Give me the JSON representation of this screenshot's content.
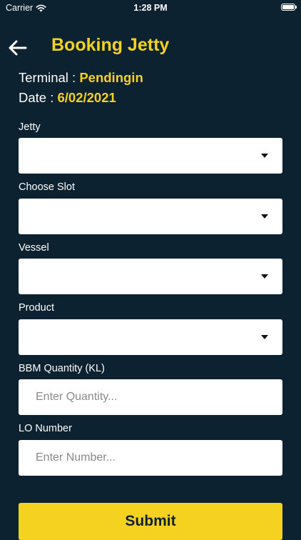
{
  "status_bar": {
    "carrier": "Carrier",
    "time": "1:28 PM"
  },
  "header": {
    "title": "Booking Jetty",
    "back_icon": "arrow-left-icon"
  },
  "info": {
    "terminal_label": "Terminal : ",
    "terminal_value": "Pendingin",
    "date_label": "Date : ",
    "date_value": "6/02/2021"
  },
  "form": {
    "jetty": {
      "label": "Jetty",
      "value": ""
    },
    "slot": {
      "label": "Choose Slot",
      "value": ""
    },
    "vessel": {
      "label": "Vessel",
      "value": ""
    },
    "product": {
      "label": "Product",
      "value": ""
    },
    "quantity": {
      "label": "BBM Quantity (KL)",
      "placeholder": "Enter Quantity...",
      "value": ""
    },
    "lo_number": {
      "label": "LO Number",
      "placeholder": "Enter Number...",
      "value": ""
    }
  },
  "submit_label": "Submit",
  "colors": {
    "background": "#0d2230",
    "accent": "#f5d21f",
    "text": "#ffffff"
  }
}
